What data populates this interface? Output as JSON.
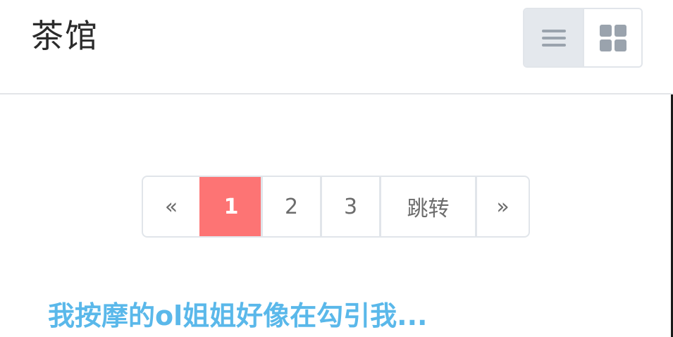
{
  "header": {
    "title": "茶馆",
    "view_toggle": {
      "list_icon": "hamburger-list-icon",
      "grid_icon": "grid-icon",
      "active": "list"
    }
  },
  "pagination": {
    "prev_label": "«",
    "pages": [
      "1",
      "2",
      "3"
    ],
    "current_page": "1",
    "jump_label": "跳转",
    "next_label": "»"
  },
  "threads": [
    {
      "title": "我按摩的ol姐姐好像在勾引我..."
    }
  ],
  "colors": {
    "accent_active": "#fd7474",
    "link": "#5ab8ea",
    "border": "#e1e5ea",
    "toggle_active_bg": "#e4e8ed"
  }
}
